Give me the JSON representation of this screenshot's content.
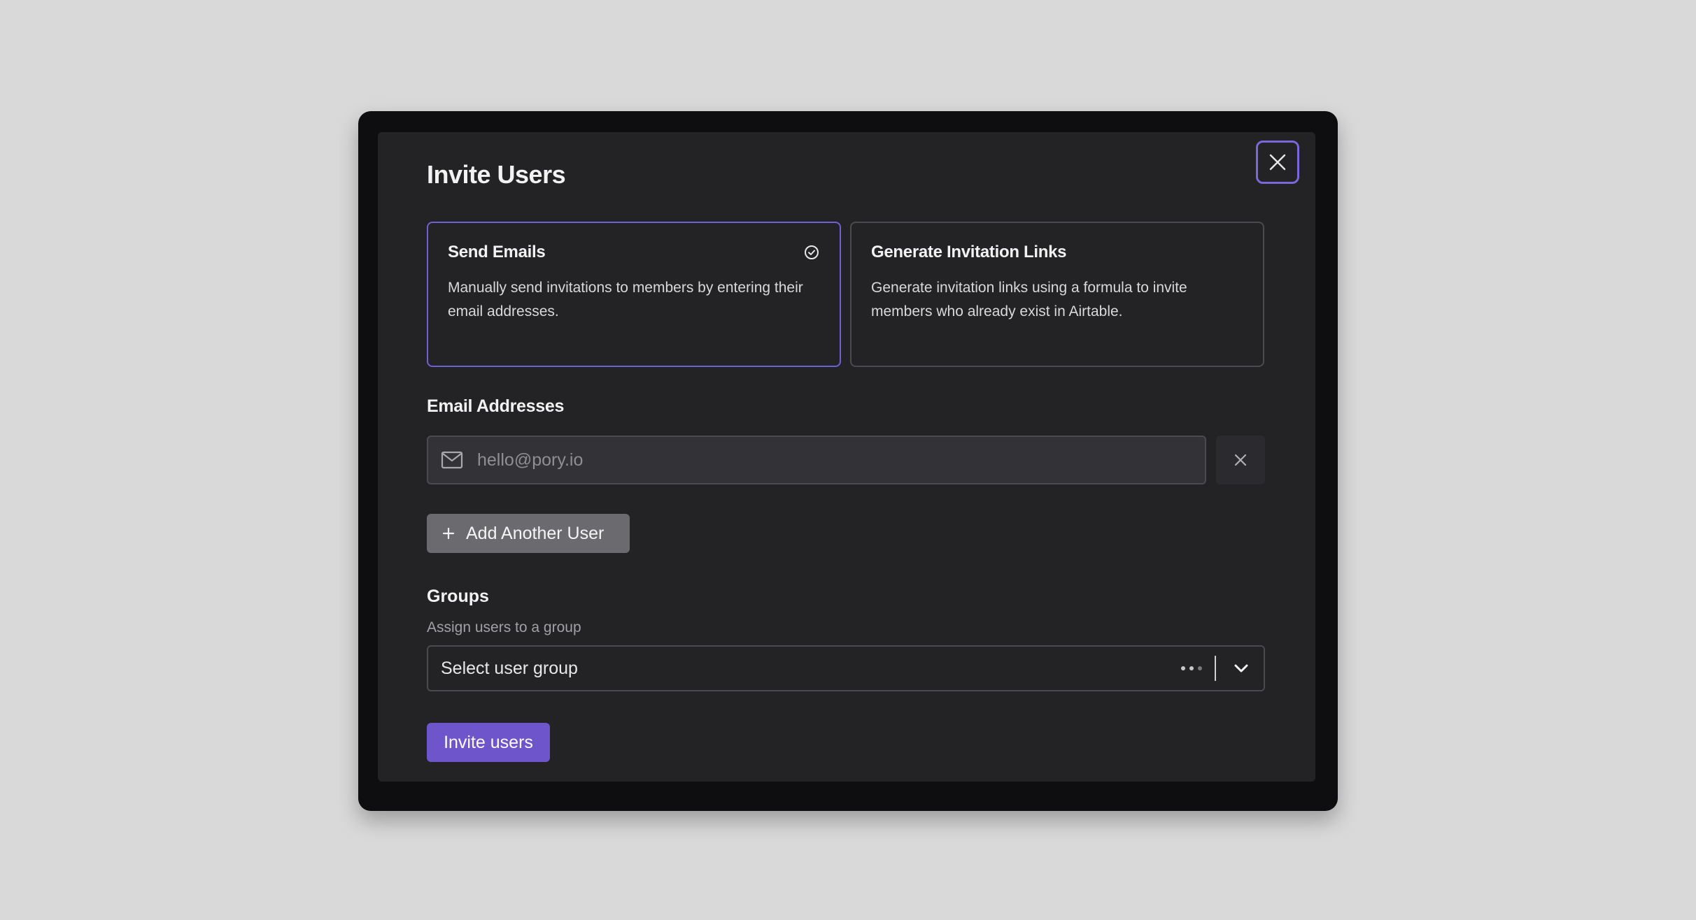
{
  "dialog": {
    "title": "Invite Users",
    "close_label": "Close"
  },
  "options": [
    {
      "title": "Send Emails",
      "description": "Manually send invitations to members by entering their email addresses.",
      "selected": true
    },
    {
      "title": "Generate Invitation Links",
      "description": "Generate invitation links using a formula to invite members who already exist in Airtable.",
      "selected": false
    }
  ],
  "email": {
    "label": "Email Addresses",
    "placeholder": "hello@pory.io",
    "value": ""
  },
  "add_user": {
    "label": "Add Another User"
  },
  "groups": {
    "label": "Groups",
    "subtitle": "Assign users to a group",
    "selected_value": "Select user group"
  },
  "submit": {
    "label": "Invite users"
  },
  "colors": {
    "accent": "#6e55cc",
    "selected_border": "#7061d2",
    "background": "#d9d9d9",
    "dialog": "#232326"
  },
  "icons": {
    "close": "close-icon",
    "check": "check-circle-icon",
    "mail": "mail-icon",
    "remove": "remove-x-icon",
    "plus": "plus-icon",
    "dots": "loading-dots-icon",
    "chevron": "chevron-down-icon"
  }
}
